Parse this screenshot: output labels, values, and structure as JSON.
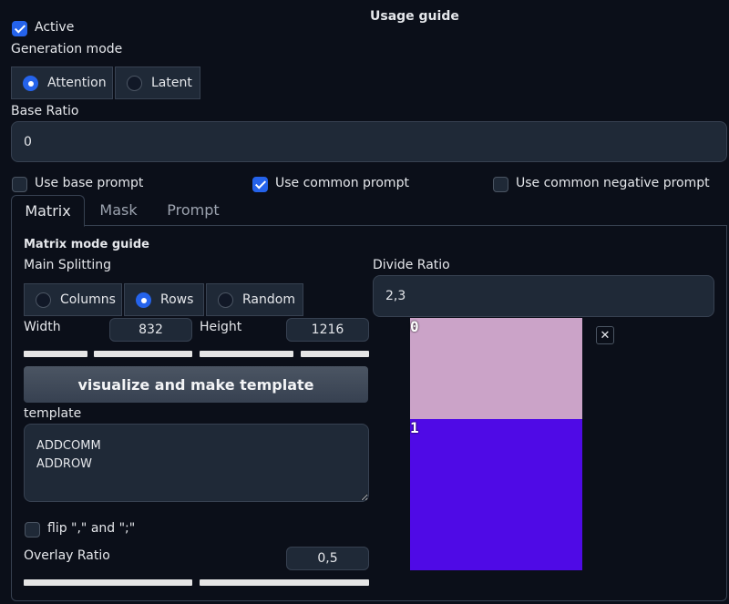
{
  "header": {
    "title": "Usage guide"
  },
  "active": {
    "label": "Active",
    "checked": true
  },
  "generation_mode": {
    "label": "Generation mode",
    "options": [
      "Attention",
      "Latent"
    ],
    "selected": "Attention"
  },
  "base_ratio": {
    "label": "Base Ratio",
    "value": "0"
  },
  "prompt_options": {
    "use_base_prompt": {
      "label": "Use base prompt",
      "checked": false
    },
    "use_common_prompt": {
      "label": "Use common prompt",
      "checked": true
    },
    "use_common_negative_prompt": {
      "label": "Use common negative prompt",
      "checked": false
    }
  },
  "tabs": [
    {
      "label": "Matrix",
      "active": true
    },
    {
      "label": "Mask",
      "active": false
    },
    {
      "label": "Prompt",
      "active": false
    }
  ],
  "matrix": {
    "guide_title": "Matrix mode guide",
    "main_splitting": {
      "label": "Main Splitting",
      "options": [
        "Columns",
        "Rows",
        "Random"
      ],
      "selected": "Rows"
    },
    "width": {
      "label": "Width",
      "value": "832"
    },
    "height": {
      "label": "Height",
      "value": "1216"
    },
    "visualize_button": "visualize and make template",
    "template": {
      "label": "template",
      "value": "ADDCOMM\nADDROW"
    },
    "flip": {
      "label": "flip \",\" and \";\"",
      "checked": false
    },
    "overlay_ratio": {
      "label": "Overlay Ratio",
      "value": "0,5"
    },
    "divide_ratio": {
      "label": "Divide Ratio",
      "value": "2,3"
    },
    "preview": {
      "regions": [
        {
          "label": "0",
          "fraction": 0.4,
          "color": "#cba3c8"
        },
        {
          "label": "1",
          "fraction": 0.6,
          "color": "#4f0ae6"
        }
      ],
      "close_icon": "close-icon"
    }
  },
  "colors": {
    "accent": "#2563eb",
    "background": "#0b0f19"
  }
}
